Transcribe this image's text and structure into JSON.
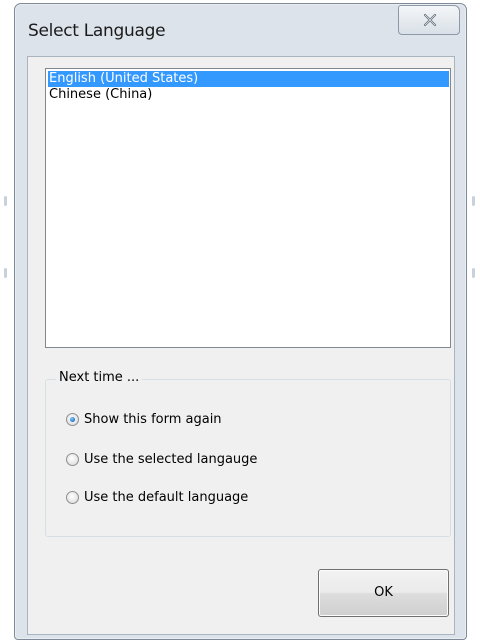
{
  "window": {
    "title": "Select Language"
  },
  "language_list": {
    "items": [
      {
        "label": "English (United States)",
        "selected": true
      },
      {
        "label": "Chinese (China)",
        "selected": false
      }
    ]
  },
  "next_time_group": {
    "label": "Next time ...",
    "options": [
      {
        "label": "Show this form again",
        "checked": true
      },
      {
        "label": "Use the selected langauge",
        "checked": false
      },
      {
        "label": "Use the default language",
        "checked": false
      }
    ]
  },
  "buttons": {
    "ok_label": "OK"
  },
  "icons": {
    "close": "close-icon",
    "radio_checked": "radio-checked",
    "radio_unchecked": "radio-unchecked"
  },
  "colors": {
    "selection": "#3399ff",
    "window_frame": "#dce3eb",
    "client_background": "#f0f0f0"
  }
}
